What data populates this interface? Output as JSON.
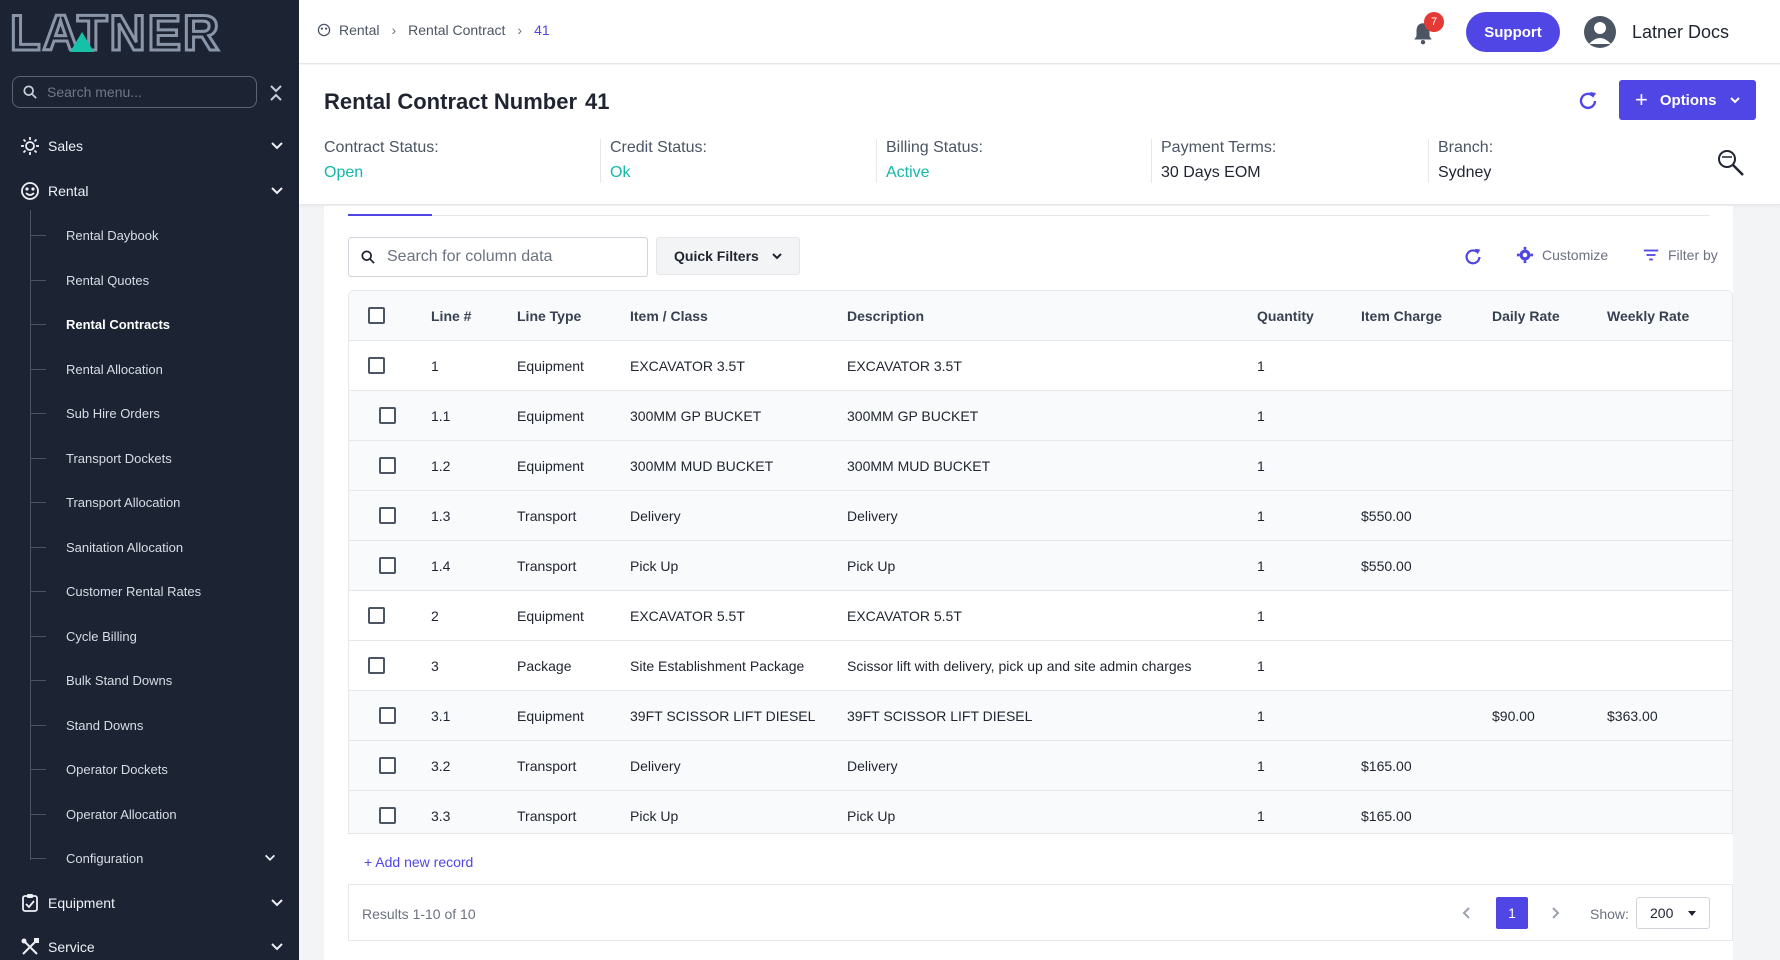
{
  "brand": {
    "logo_text": "LATNER"
  },
  "sidebar": {
    "search_placeholder": "Search menu...",
    "top_items": [
      {
        "label": "Sales",
        "icon": "sales-icon"
      },
      {
        "label": "Rental",
        "icon": "rental-icon"
      },
      {
        "label": "Equipment",
        "icon": "clipboard-icon"
      },
      {
        "label": "Service",
        "icon": "tools-icon"
      }
    ],
    "rental_items": [
      "Rental Daybook",
      "Rental Quotes",
      "Rental Contracts",
      "Rental Allocation",
      "Sub Hire Orders",
      "Transport Dockets",
      "Transport Allocation",
      "Sanitation Allocation",
      "Customer Rental Rates",
      "Cycle Billing",
      "Bulk Stand Downs",
      "Stand Downs",
      "Operator Dockets",
      "Operator Allocation",
      "Configuration"
    ],
    "active_item": "Rental Contracts"
  },
  "topbar": {
    "breadcrumb": [
      "Rental",
      "Rental Contract",
      "41"
    ],
    "notification_count": "7",
    "support_label": "Support",
    "user_name": "Latner Docs"
  },
  "header": {
    "title": "Rental Contract Number",
    "number": "41",
    "options_label": "Options",
    "statuses": [
      {
        "label": "Contract Status:",
        "value": "Open"
      },
      {
        "label": "Credit Status:",
        "value": "Ok"
      },
      {
        "label": "Billing Status:",
        "value": "Active"
      },
      {
        "label": "Payment Terms:",
        "value": "30 Days EOM"
      },
      {
        "label": "Branch:",
        "value": "Sydney"
      }
    ],
    "status_colors": {
      "teal": "#14b8a6"
    }
  },
  "grid": {
    "search_placeholder": "Search for column data",
    "quick_filters_label": "Quick Filters",
    "customize_label": "Customize",
    "filter_by_label": "Filter by",
    "columns": [
      "Line #",
      "Line Type",
      "Item / Class",
      "Description",
      "Quantity",
      "Item Charge",
      "Daily Rate",
      "Weekly Rate"
    ],
    "rows": [
      {
        "line": "1",
        "type": "Equipment",
        "item": "EXCAVATOR 3.5T",
        "desc": "EXCAVATOR 3.5T",
        "qty": "1",
        "charge": "",
        "daily": "",
        "weekly": ""
      },
      {
        "line": "1.1",
        "type": "Equipment",
        "item": "300MM GP BUCKET",
        "desc": "300MM GP BUCKET",
        "qty": "1",
        "charge": "",
        "daily": "",
        "weekly": ""
      },
      {
        "line": "1.2",
        "type": "Equipment",
        "item": "300MM MUD BUCKET",
        "desc": "300MM MUD BUCKET",
        "qty": "1",
        "charge": "",
        "daily": "",
        "weekly": ""
      },
      {
        "line": "1.3",
        "type": "Transport",
        "item": "Delivery",
        "desc": "Delivery",
        "qty": "1",
        "charge": "$550.00",
        "daily": "",
        "weekly": ""
      },
      {
        "line": "1.4",
        "type": "Transport",
        "item": "Pick Up",
        "desc": "Pick Up",
        "qty": "1",
        "charge": "$550.00",
        "daily": "",
        "weekly": ""
      },
      {
        "line": "2",
        "type": "Equipment",
        "item": "EXCAVATOR 5.5T",
        "desc": "EXCAVATOR 5.5T",
        "qty": "1",
        "charge": "",
        "daily": "",
        "weekly": ""
      },
      {
        "line": "3",
        "type": "Package",
        "item": "Site Establishment Package",
        "desc": "Scissor lift with delivery, pick up and site admin charges",
        "qty": "1",
        "charge": "",
        "daily": "",
        "weekly": ""
      },
      {
        "line": "3.1",
        "type": "Equipment",
        "item": "39FT SCISSOR LIFT DIESEL",
        "desc": "39FT SCISSOR LIFT DIESEL",
        "qty": "1",
        "charge": "",
        "daily": "$90.00",
        "weekly": "$363.00"
      },
      {
        "line": "3.2",
        "type": "Transport",
        "item": "Delivery",
        "desc": "Delivery",
        "qty": "1",
        "charge": "$165.00",
        "daily": "",
        "weekly": ""
      },
      {
        "line": "3.3",
        "type": "Transport",
        "item": "Pick Up",
        "desc": "Pick Up",
        "qty": "1",
        "charge": "$165.00",
        "daily": "",
        "weekly": ""
      }
    ],
    "add_record_label": "+ Add new record",
    "results_text": "Results 1-10 of 10",
    "current_page": "1",
    "show_label": "Show:",
    "page_size": "200"
  },
  "colors": {
    "accent": "#4f46e5",
    "sidebar_bg": "#1c2434",
    "badge": "#e53935"
  }
}
